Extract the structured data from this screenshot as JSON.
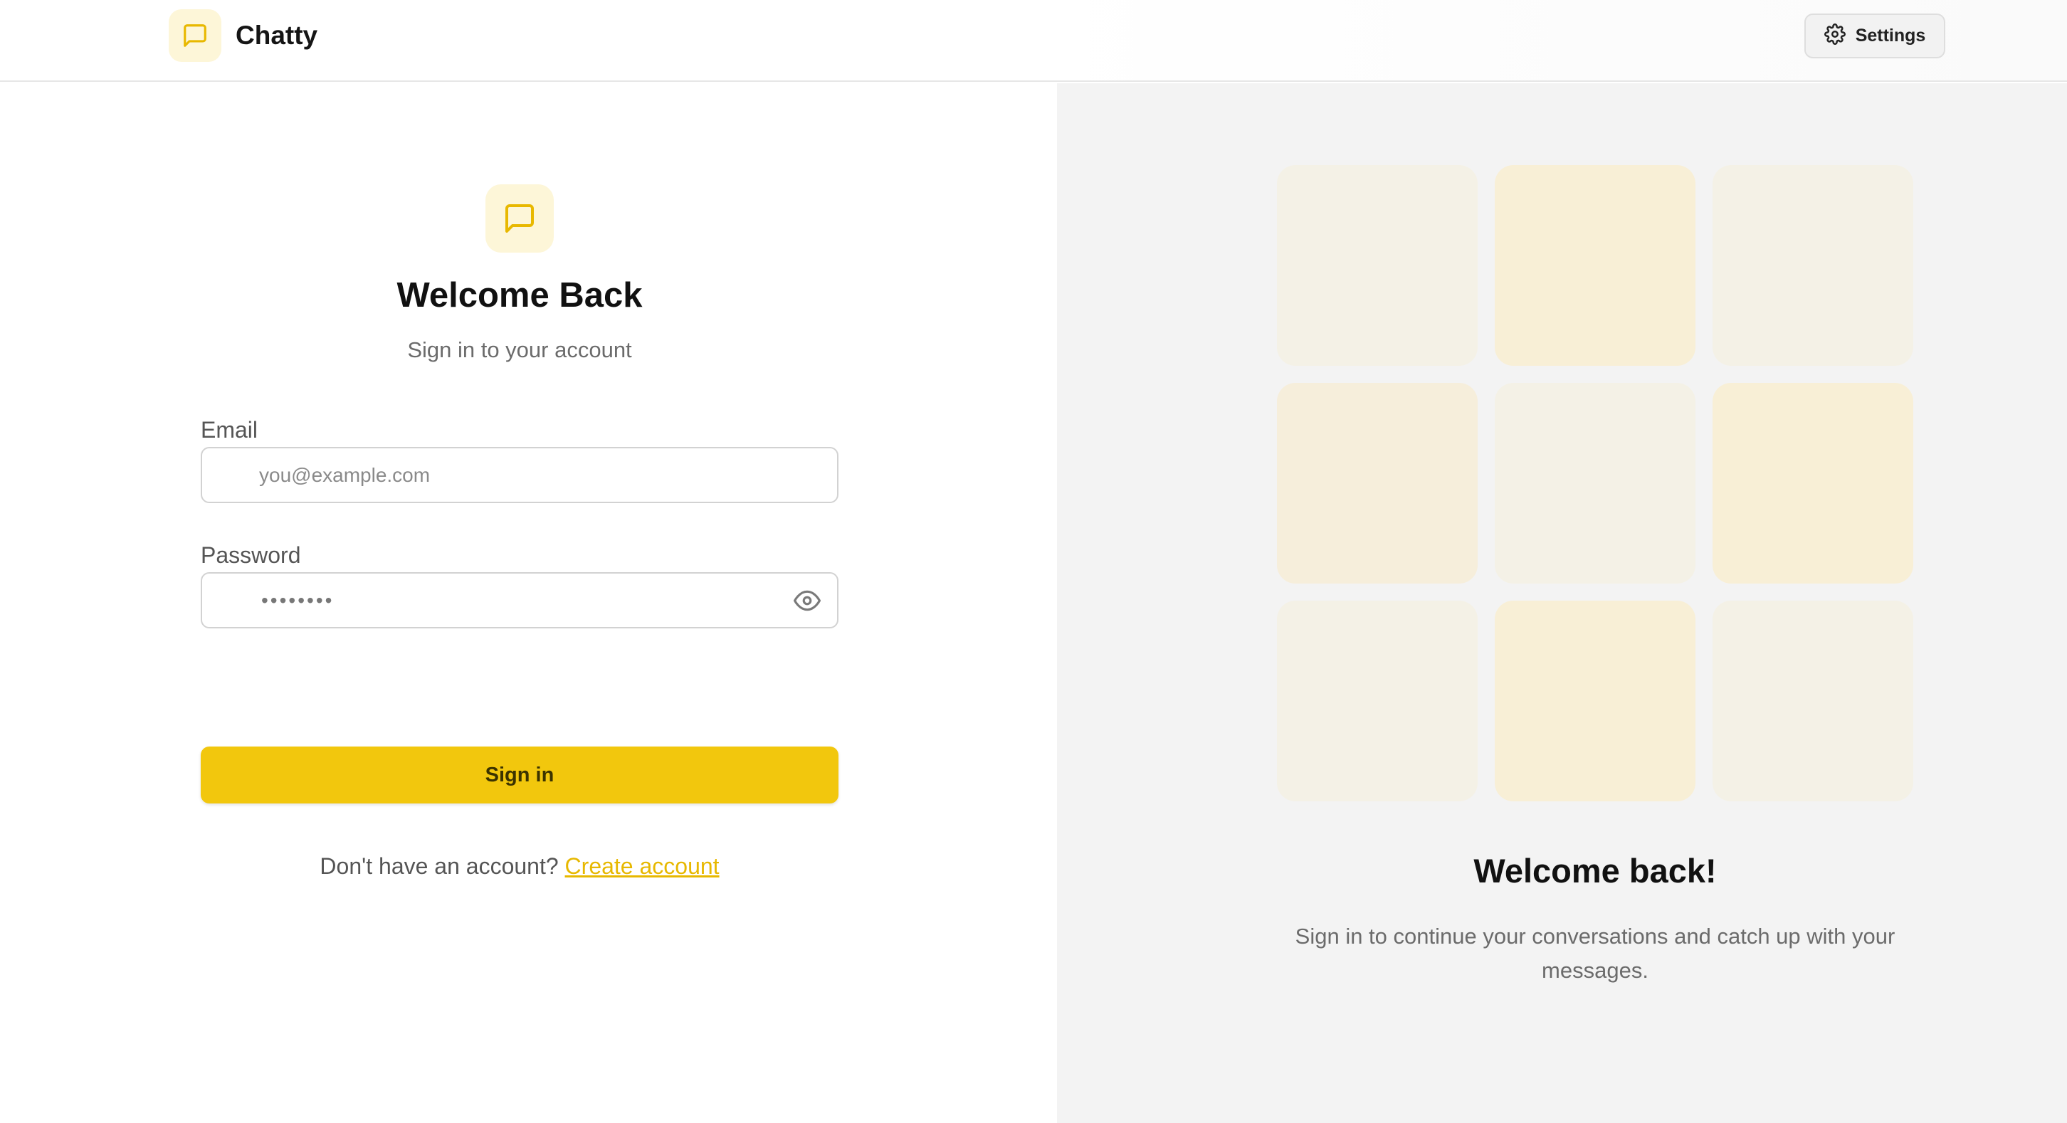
{
  "app": {
    "name": "Chatty"
  },
  "header": {
    "settings_label": "Settings"
  },
  "login": {
    "title": "Welcome Back",
    "subtitle": "Sign in to your account",
    "email_label": "Email",
    "email_placeholder": "you@example.com",
    "password_label": "Password",
    "password_value": "••••••••",
    "submit_label": "Sign in",
    "signup_prompt": "Don't have an account?",
    "signup_link": "Create account"
  },
  "promo": {
    "title": "Welcome back!",
    "description": "Sign in to continue your conversations and catch up with your messages."
  },
  "colors": {
    "accent": "#f2c70d",
    "accent_soft": "#fdf6d8",
    "link": "#e7b800",
    "tile_warm": "#f8efd6",
    "tile_light": "#f4f1e6"
  },
  "icons": {
    "brand": "message-square-icon",
    "settings": "gear-icon",
    "password_toggle": "eye-icon"
  }
}
